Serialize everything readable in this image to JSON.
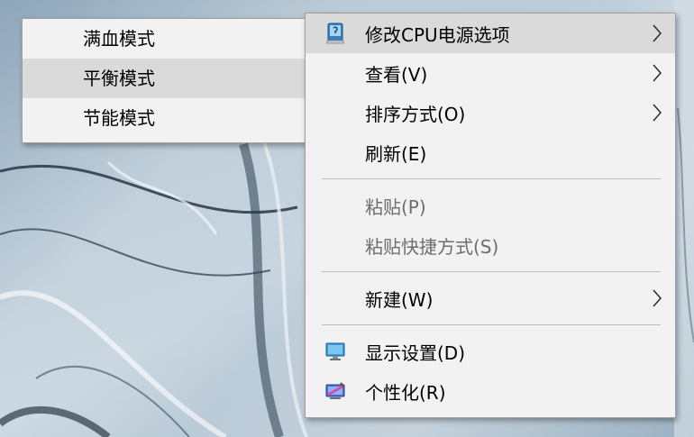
{
  "submenu": {
    "items": [
      {
        "label": "满血模式",
        "highlighted": false
      },
      {
        "label": "平衡模式",
        "highlighted": true
      },
      {
        "label": "节能模式",
        "highlighted": false
      }
    ]
  },
  "context_menu": {
    "items": [
      {
        "label": "修改CPU电源选项",
        "icon": "power-options-icon",
        "has_submenu": true,
        "highlighted": true
      },
      {
        "label": "查看(V)",
        "has_submenu": true
      },
      {
        "label": "排序方式(O)",
        "has_submenu": true
      },
      {
        "label": "刷新(E)"
      },
      {
        "label": "粘贴(P)",
        "disabled": true
      },
      {
        "label": "粘贴快捷方式(S)",
        "disabled": true
      },
      {
        "label": "新建(W)",
        "has_submenu": true
      },
      {
        "label": "显示设置(D)",
        "icon": "display-settings-icon"
      },
      {
        "label": "个性化(R)",
        "icon": "personalize-icon"
      }
    ]
  },
  "colors": {
    "menu_bg": "#f2f2f2",
    "highlight": "#dadada",
    "disabled_text": "#6d6d6d"
  }
}
